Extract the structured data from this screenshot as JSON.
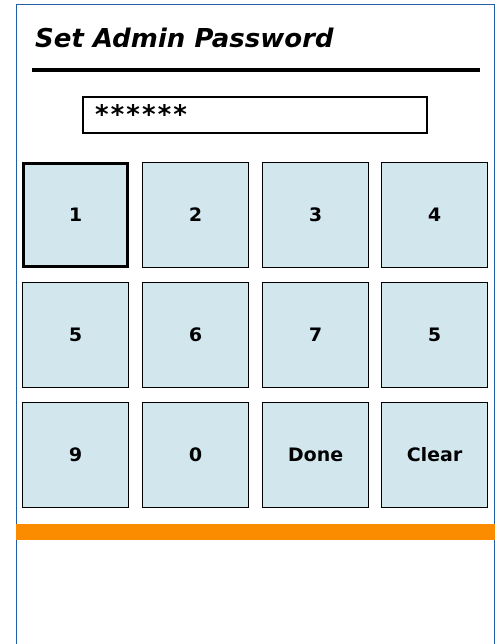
{
  "screen": {
    "title": "Set Admin Password"
  },
  "password_field": {
    "value": "******"
  },
  "keypad": {
    "keys": [
      {
        "label": "1",
        "selected": true
      },
      {
        "label": "2"
      },
      {
        "label": "3"
      },
      {
        "label": "4"
      },
      {
        "label": "5"
      },
      {
        "label": "6"
      },
      {
        "label": "7"
      },
      {
        "label": "5"
      },
      {
        "label": "9"
      },
      {
        "label": "0"
      },
      {
        "label": "Done"
      },
      {
        "label": "Clear"
      }
    ]
  },
  "colors": {
    "key_background": "#d2e6ee",
    "accent_bar": "#fb8c00",
    "frame_border": "#1f5fa8"
  }
}
